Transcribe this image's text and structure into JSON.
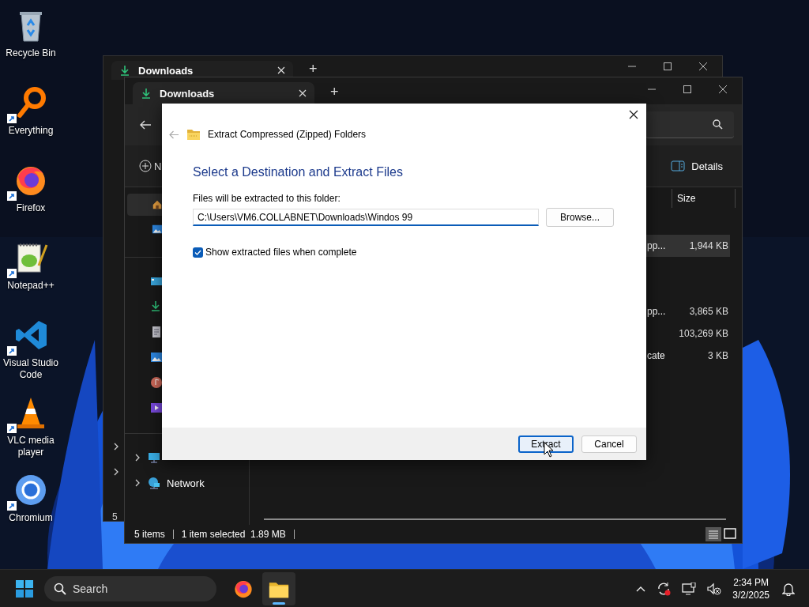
{
  "desktop_icons": [
    {
      "kind": "recycle-bin",
      "label": "Recycle Bin",
      "shortcut": false
    },
    {
      "kind": "magnifier",
      "label": "Everything",
      "shortcut": true
    },
    {
      "kind": "flame-globe",
      "label": "Firefox",
      "shortcut": true
    },
    {
      "kind": "notepad",
      "label": "Notepad++",
      "shortcut": true
    },
    {
      "kind": "ribbon",
      "label": "Visual Studio Code",
      "shortcut": true
    },
    {
      "kind": "cone",
      "label": "VLC media player",
      "shortcut": true
    },
    {
      "kind": "ring",
      "label": "Chromium",
      "shortcut": true
    }
  ],
  "back_window": {
    "tab": {
      "label": "Downloads",
      "new_tab_button": "+"
    },
    "sidebar_tree": [
      {
        "expanded": false
      },
      {
        "expanded": false
      }
    ],
    "status_bar": {
      "item_count": "5"
    }
  },
  "explorer": {
    "tab": {
      "label": "Downloads",
      "new_tab_button": "+"
    },
    "command_bar": {
      "new_label": "N",
      "details_label": "Details"
    },
    "sidebar": {
      "pinned": [
        {
          "kind": "home",
          "selected": true
        },
        {
          "kind": "gallery",
          "selected": false
        }
      ],
      "folders": [
        {
          "kind": "desktop"
        },
        {
          "kind": "downloads"
        },
        {
          "kind": "documents"
        },
        {
          "kind": "pictures"
        },
        {
          "kind": "music"
        },
        {
          "kind": "videos"
        }
      ],
      "tree": [
        {
          "kind": "pc",
          "expanded": false
        },
        {
          "kind": "network",
          "label": "Network",
          "expanded": false
        }
      ]
    },
    "columns": [
      {
        "label": "Size"
      }
    ],
    "rows": [
      {
        "type": "pp...",
        "size": "1,944 KB",
        "selected": true
      },
      {
        "type": "pp...",
        "size": "3,865 KB",
        "selected": false
      },
      {
        "size": "103,269 KB",
        "selected": false
      },
      {
        "type": "cate",
        "size": "3 KB",
        "selected": false
      }
    ],
    "status_bar": {
      "item_count": "5 items",
      "selection": "1 item selected",
      "size": "1.89 MB"
    }
  },
  "dialog": {
    "title": "Extract Compressed (Zipped) Folders",
    "heading": "Select a Destination and Extract Files",
    "folder_label": "Files will be extracted to this folder:",
    "path": "C:\\Users\\VM6.COLLABNET\\Downloads\\Windos 99",
    "browse_button": "Browse...",
    "show_files": {
      "label": "Show extracted files when complete",
      "checked": true
    },
    "buttons": [
      {
        "label": "Extract",
        "default": true
      },
      {
        "label": "Cancel",
        "default": false
      }
    ]
  },
  "taskbar": {
    "search_placeholder": "Search",
    "apps": [
      {
        "kind": "flame-globe",
        "active": false
      },
      {
        "kind": "folder",
        "active": true
      }
    ],
    "time": "2:34 PM",
    "date": "3/2/2025"
  }
}
